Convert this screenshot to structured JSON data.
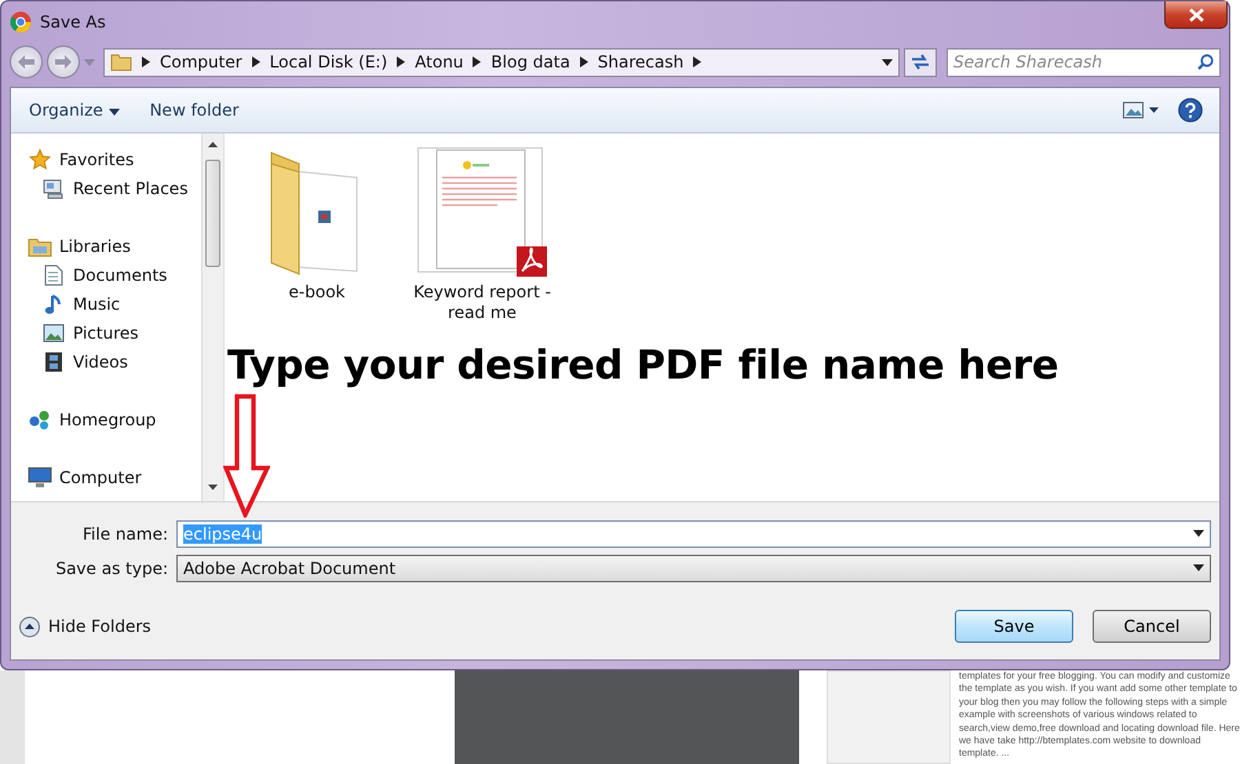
{
  "window": {
    "title": "Save As"
  },
  "address_bar": {
    "path": [
      "Computer",
      "Local Disk (E:)",
      "Atonu",
      "Blog data",
      "Sharecash"
    ]
  },
  "search": {
    "placeholder": "Search Sharecash"
  },
  "toolbar": {
    "buttons": [
      {
        "label": "Organize",
        "kind": "menu"
      },
      {
        "label": "New folder",
        "kind": "plain"
      }
    ]
  },
  "sidebar": {
    "items": [
      {
        "label": "Favorites",
        "kind": "star",
        "children": [
          {
            "label": "Recent Places",
            "kind": "recent"
          }
        ]
      },
      {
        "label": "Libraries",
        "kind": "library",
        "children": [
          {
            "label": "Documents",
            "kind": "document"
          },
          {
            "label": "Music",
            "kind": "music"
          },
          {
            "label": "Pictures",
            "kind": "picture"
          },
          {
            "label": "Videos",
            "kind": "video"
          }
        ]
      },
      {
        "label": "Homegroup",
        "kind": "homegroup"
      },
      {
        "label": "Computer",
        "kind": "computer"
      }
    ]
  },
  "files": [
    {
      "name": "e-book",
      "kind": "folder"
    },
    {
      "name": "Keyword report - read me",
      "kind": "pdf"
    }
  ],
  "annotation": {
    "text": "Type your desired PDF file name here"
  },
  "file_name": {
    "label": "File name:",
    "value": "eclipse4u",
    "text_selected": true
  },
  "save_as_type": {
    "label": "Save as type:",
    "value": "Adobe Acrobat Document"
  },
  "hide_folders": {
    "label": "Hide Folders"
  },
  "buttons": [
    {
      "label": "Save",
      "kind": "default"
    },
    {
      "label": "Cancel",
      "kind": "normal"
    }
  ],
  "background_page": {
    "paragraph": "templates for your free blogging. You can modify and customize the template as you wish. If you want add some other template to your blog then you may follow the following steps with a simple example with screenshots of various windows related to search,view demo,free download and locating download file. Here we have take http://btemplates.com website to download template.  ..."
  }
}
